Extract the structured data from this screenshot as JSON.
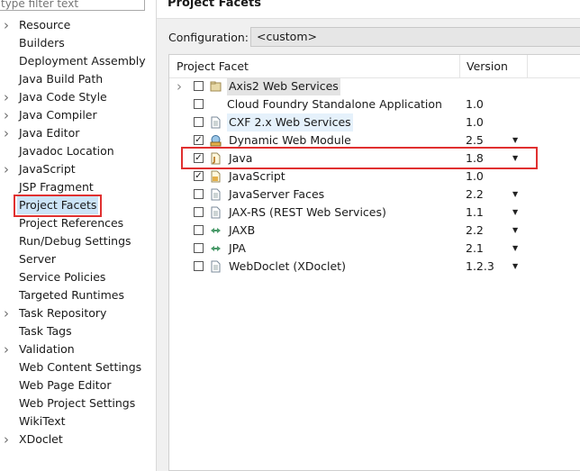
{
  "filter": {
    "placeholder": "type filter text"
  },
  "nav": {
    "items": [
      {
        "label": "Resource",
        "arrow": true
      },
      {
        "label": "Builders",
        "arrow": false
      },
      {
        "label": "Deployment Assembly",
        "arrow": false
      },
      {
        "label": "Java Build Path",
        "arrow": false
      },
      {
        "label": "Java Code Style",
        "arrow": true
      },
      {
        "label": "Java Compiler",
        "arrow": true
      },
      {
        "label": "Java Editor",
        "arrow": true
      },
      {
        "label": "Javadoc Location",
        "arrow": false
      },
      {
        "label": "JavaScript",
        "arrow": true
      },
      {
        "label": "JSP Fragment",
        "arrow": false
      },
      {
        "label": "Project Facets",
        "arrow": false,
        "selected": true
      },
      {
        "label": "Project References",
        "arrow": false
      },
      {
        "label": "Run/Debug Settings",
        "arrow": false
      },
      {
        "label": "Server",
        "arrow": false
      },
      {
        "label": "Service Policies",
        "arrow": false
      },
      {
        "label": "Targeted Runtimes",
        "arrow": false
      },
      {
        "label": "Task Repository",
        "arrow": true
      },
      {
        "label": "Task Tags",
        "arrow": false
      },
      {
        "label": "Validation",
        "arrow": true
      },
      {
        "label": "Web Content Settings",
        "arrow": false
      },
      {
        "label": "Web Page Editor",
        "arrow": false
      },
      {
        "label": "Web Project Settings",
        "arrow": false
      },
      {
        "label": "WikiText",
        "arrow": false
      },
      {
        "label": "XDoclet",
        "arrow": true
      }
    ]
  },
  "page": {
    "title": "Project Facets"
  },
  "configuration": {
    "label": "Configuration:",
    "value": "<custom>"
  },
  "table": {
    "headers": {
      "facet": "Project Facet",
      "version": "Version"
    },
    "rows": [
      {
        "name": "Axis2 Web Services",
        "version": "",
        "checked": false,
        "expandable": true,
        "dropdown": false,
        "icon": "folder-icon",
        "highlight": "gray"
      },
      {
        "name": "Cloud Foundry Standalone Application",
        "version": "1.0",
        "checked": false,
        "expandable": false,
        "dropdown": false,
        "icon": "none",
        "highlight": ""
      },
      {
        "name": "CXF 2.x Web Services",
        "version": "1.0",
        "checked": false,
        "expandable": false,
        "dropdown": false,
        "icon": "page-icon",
        "highlight": "blue"
      },
      {
        "name": "Dynamic Web Module",
        "version": "2.5",
        "checked": true,
        "expandable": false,
        "dropdown": true,
        "icon": "web-module-icon",
        "highlight": ""
      },
      {
        "name": "Java",
        "version": "1.8",
        "checked": true,
        "expandable": false,
        "dropdown": true,
        "icon": "java-icon",
        "highlight": ""
      },
      {
        "name": "JavaScript",
        "version": "1.0",
        "checked": true,
        "expandable": false,
        "dropdown": false,
        "icon": "javascript-icon",
        "highlight": ""
      },
      {
        "name": "JavaServer Faces",
        "version": "2.2",
        "checked": false,
        "expandable": false,
        "dropdown": true,
        "icon": "page-icon",
        "highlight": ""
      },
      {
        "name": "JAX-RS (REST Web Services)",
        "version": "1.1",
        "checked": false,
        "expandable": false,
        "dropdown": true,
        "icon": "page-icon",
        "highlight": ""
      },
      {
        "name": "JAXB",
        "version": "2.2",
        "checked": false,
        "expandable": false,
        "dropdown": true,
        "icon": "arrows-icon",
        "highlight": ""
      },
      {
        "name": "JPA",
        "version": "2.1",
        "checked": false,
        "expandable": false,
        "dropdown": true,
        "icon": "arrows-icon",
        "highlight": ""
      },
      {
        "name": "WebDoclet (XDoclet)",
        "version": "1.2.3",
        "checked": false,
        "expandable": false,
        "dropdown": true,
        "icon": "page-icon",
        "highlight": ""
      }
    ]
  },
  "colors": {
    "annotation": "#e03030",
    "selection": "#cce4f7"
  }
}
